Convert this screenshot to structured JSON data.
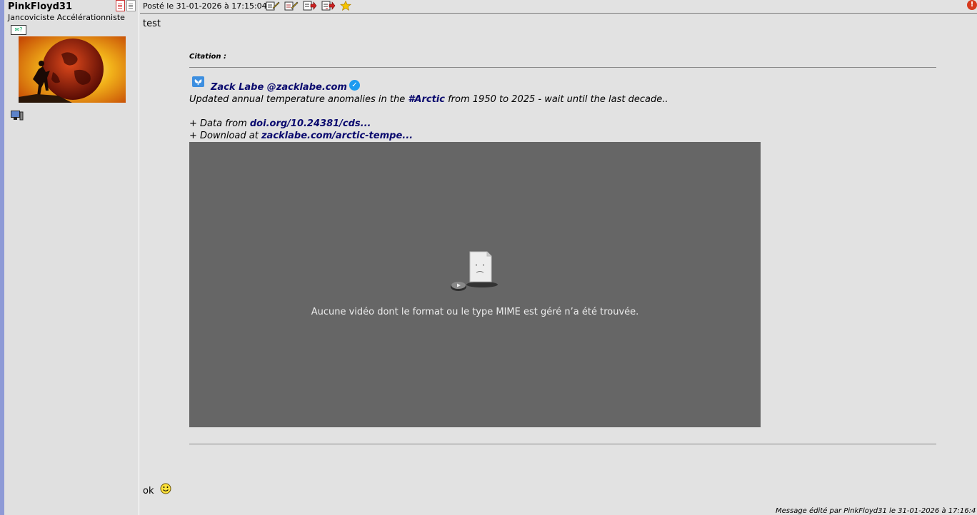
{
  "profile": {
    "username": "PinkFloyd31",
    "title": "Jancoviciste Accélérationniste",
    "contact_icon_text": "✉?"
  },
  "post": {
    "date": "Posté le 31-01-2026 à 17:15:04",
    "text": "test",
    "quote": {
      "label": "Citation :",
      "author": "Zack Labe @zacklabe.com",
      "line1_prefix": "Updated annual temperature anomalies in the ",
      "line1_hashtag": "#Arctic",
      "line1_suffix": " from 1950 to 2025 - wait until the last decade..",
      "line2_prefix": "+ Data from ",
      "line2_link": "doi.org/10.24381/cds...",
      "line3_prefix": "+ Download at ",
      "line3_link": "zacklabe.com/arctic-tempe...",
      "video_error": "Aucune vidéo dont le format ou le type MIME est géré n’a été trouvée."
    },
    "footer_text": "ok",
    "edited_note": "Message édité par PinkFloyd31 le 31-01-2026 à 17:16:4"
  },
  "colors": {
    "background": "#e2e2e2",
    "left_bar": "#8e9ad6",
    "link": "#0a0a6e",
    "video_bg": "#666666",
    "alert": "#d63a1e"
  }
}
